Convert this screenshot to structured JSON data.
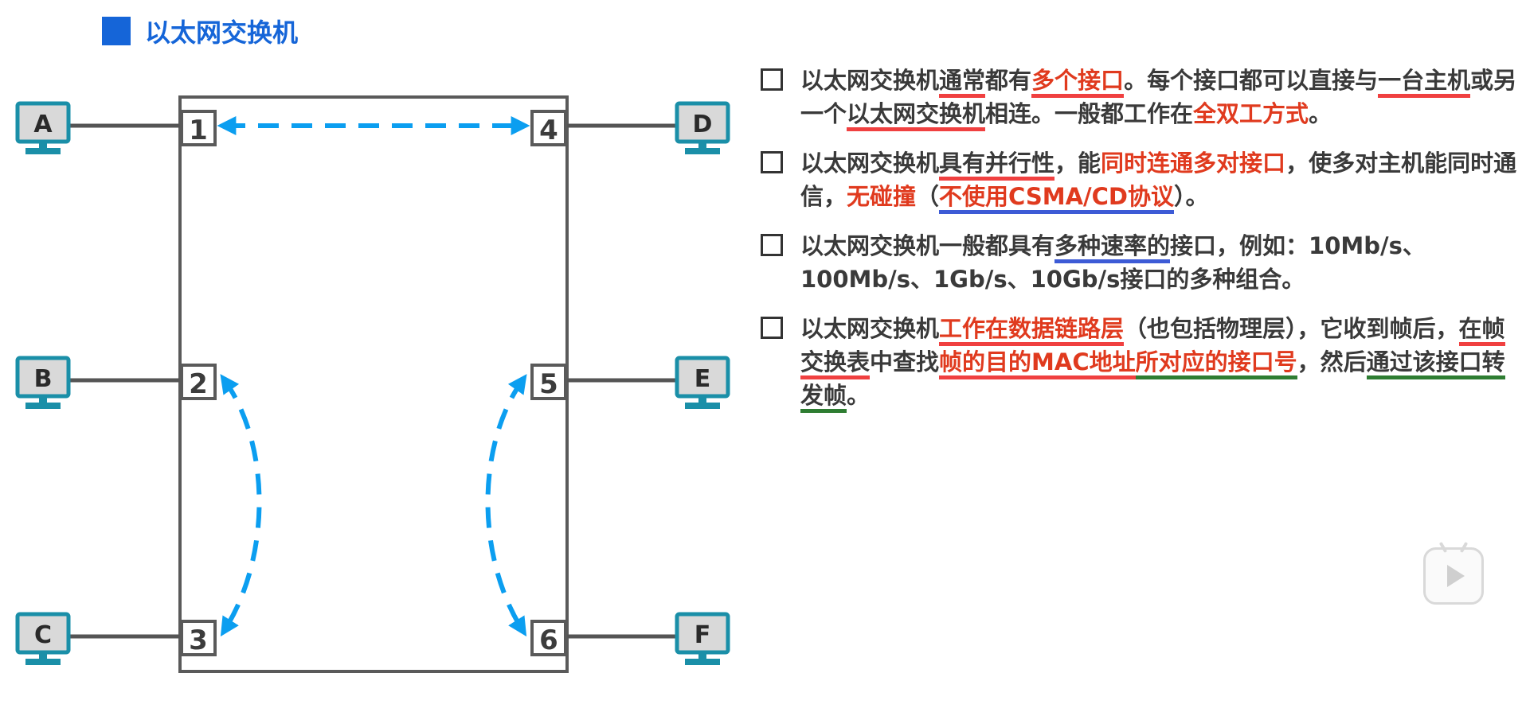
{
  "title": "以太网交换机",
  "hosts": [
    {
      "id": "A",
      "label": "A"
    },
    {
      "id": "B",
      "label": "B"
    },
    {
      "id": "C",
      "label": "C"
    },
    {
      "id": "D",
      "label": "D"
    },
    {
      "id": "E",
      "label": "E"
    },
    {
      "id": "F",
      "label": "F"
    }
  ],
  "ports": [
    "1",
    "2",
    "3",
    "4",
    "5",
    "6"
  ],
  "colors": {
    "title": "#1565d8",
    "arrow": "#0b9ef0",
    "monitor": "#1a8fa8",
    "highlight_red": "#e03a1e",
    "underline_red": "#f04040",
    "underline_blue": "#3d5bd6",
    "underline_green": "#2e7d32"
  },
  "bullets": [
    {
      "s1": "以太网交换机",
      "s2": "通常",
      "s3": "都有",
      "s4": "多个接口",
      "s5": "。每个接口都可以直接与",
      "s6": "一台主机",
      "s7": "或另一个",
      "s8": "以太网交换机",
      "s9": "相连。一般都工作在",
      "s10": "全双工方式",
      "s11": "。"
    },
    {
      "s1": "以太网交换机",
      "s2": "具有并行性",
      "s3": "，能",
      "s4": "同时连通多对接口",
      "s5": "，使多对主机能同时通信，",
      "s6": "无碰撞",
      "s7": "（",
      "s8": "不使用CSMA/CD协议",
      "s9": "）。"
    },
    {
      "s1": "以太网交换机一般都具有",
      "s2": "多种速率的",
      "s3": "接口，例如：10Mb/s、100Mb/s、1Gb/s、10Gb/s接口的多种组合。"
    },
    {
      "s1": "以太网交换机",
      "s2": "工作在数据链路层",
      "s3": "（也包括物理层），它收到帧后，",
      "s4": "在帧交换表",
      "s5": "中查找",
      "s6": "帧的目的MAC地址",
      "s7": "所对应的接口号",
      "s8": "，然后",
      "s9": "通过该接口转发帧",
      "s10": "。"
    }
  ],
  "play_icon": "play-icon"
}
